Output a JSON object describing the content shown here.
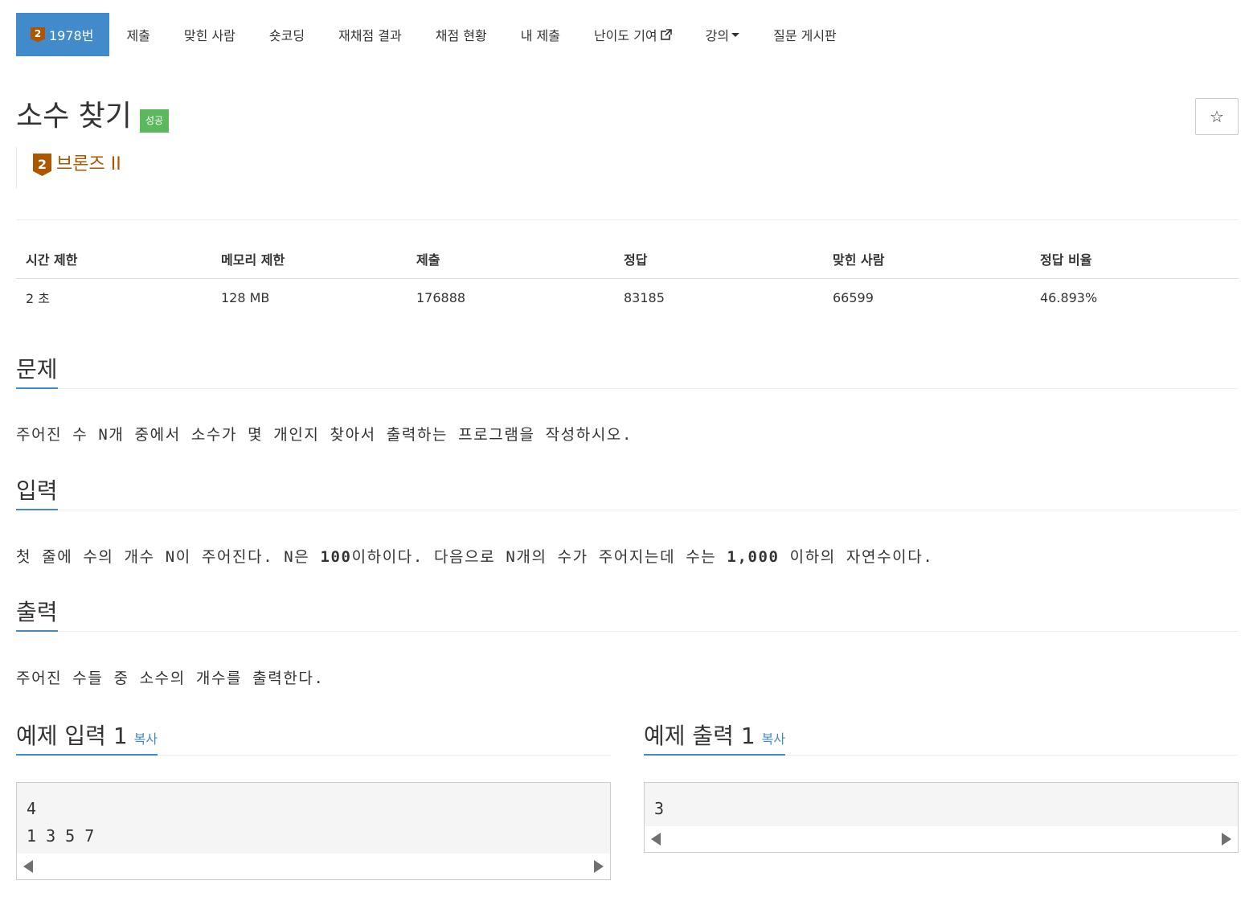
{
  "tabs": [
    {
      "label": "1978번",
      "badge": "2"
    },
    {
      "label": "제출"
    },
    {
      "label": "맞힌 사람"
    },
    {
      "label": "숏코딩"
    },
    {
      "label": "재채점 결과"
    },
    {
      "label": "채점 현황"
    },
    {
      "label": "내 제출"
    },
    {
      "label": "난이도 기여"
    },
    {
      "label": "강의"
    },
    {
      "label": "질문 게시판"
    }
  ],
  "problem": {
    "title": "소수 찾기",
    "status": "성공",
    "star": "☆",
    "tier_badge": "2",
    "tier_name": "브론즈 II"
  },
  "info": {
    "headers": [
      "시간 제한",
      "메모리 제한",
      "제출",
      "정답",
      "맞힌 사람",
      "정답 비율"
    ],
    "values": [
      "2 초",
      "128 MB",
      "176888",
      "83185",
      "66599",
      "46.893%"
    ]
  },
  "sections": {
    "problem_heading": "문제",
    "problem_text": "주어진 수 N개 중에서 소수가 몇 개인지 찾아서 출력하는 프로그램을 작성하시오.",
    "input_heading": "입력",
    "input_text_a": "첫 줄에 수의 개수 N이 주어진다. N은 ",
    "input_text_b": "100",
    "input_text_c": "이하이다. 다음으로 N개의 수가 주어지는데 수는 ",
    "input_text_d": "1,000",
    "input_text_e": " 이하의 자연수이다.",
    "output_heading": "출력",
    "output_text": "주어진 수들 중 소수의 개수를 출력한다."
  },
  "examples": {
    "input_heading": "예제 입력 1",
    "output_heading": "예제 출력 1",
    "copy_label": "복사",
    "input_lines": "4\n1 3 5 7",
    "output_lines": "3"
  },
  "colors": {
    "accent": "#428bca",
    "success": "#5cb85c",
    "bronze": "#ad5600"
  }
}
